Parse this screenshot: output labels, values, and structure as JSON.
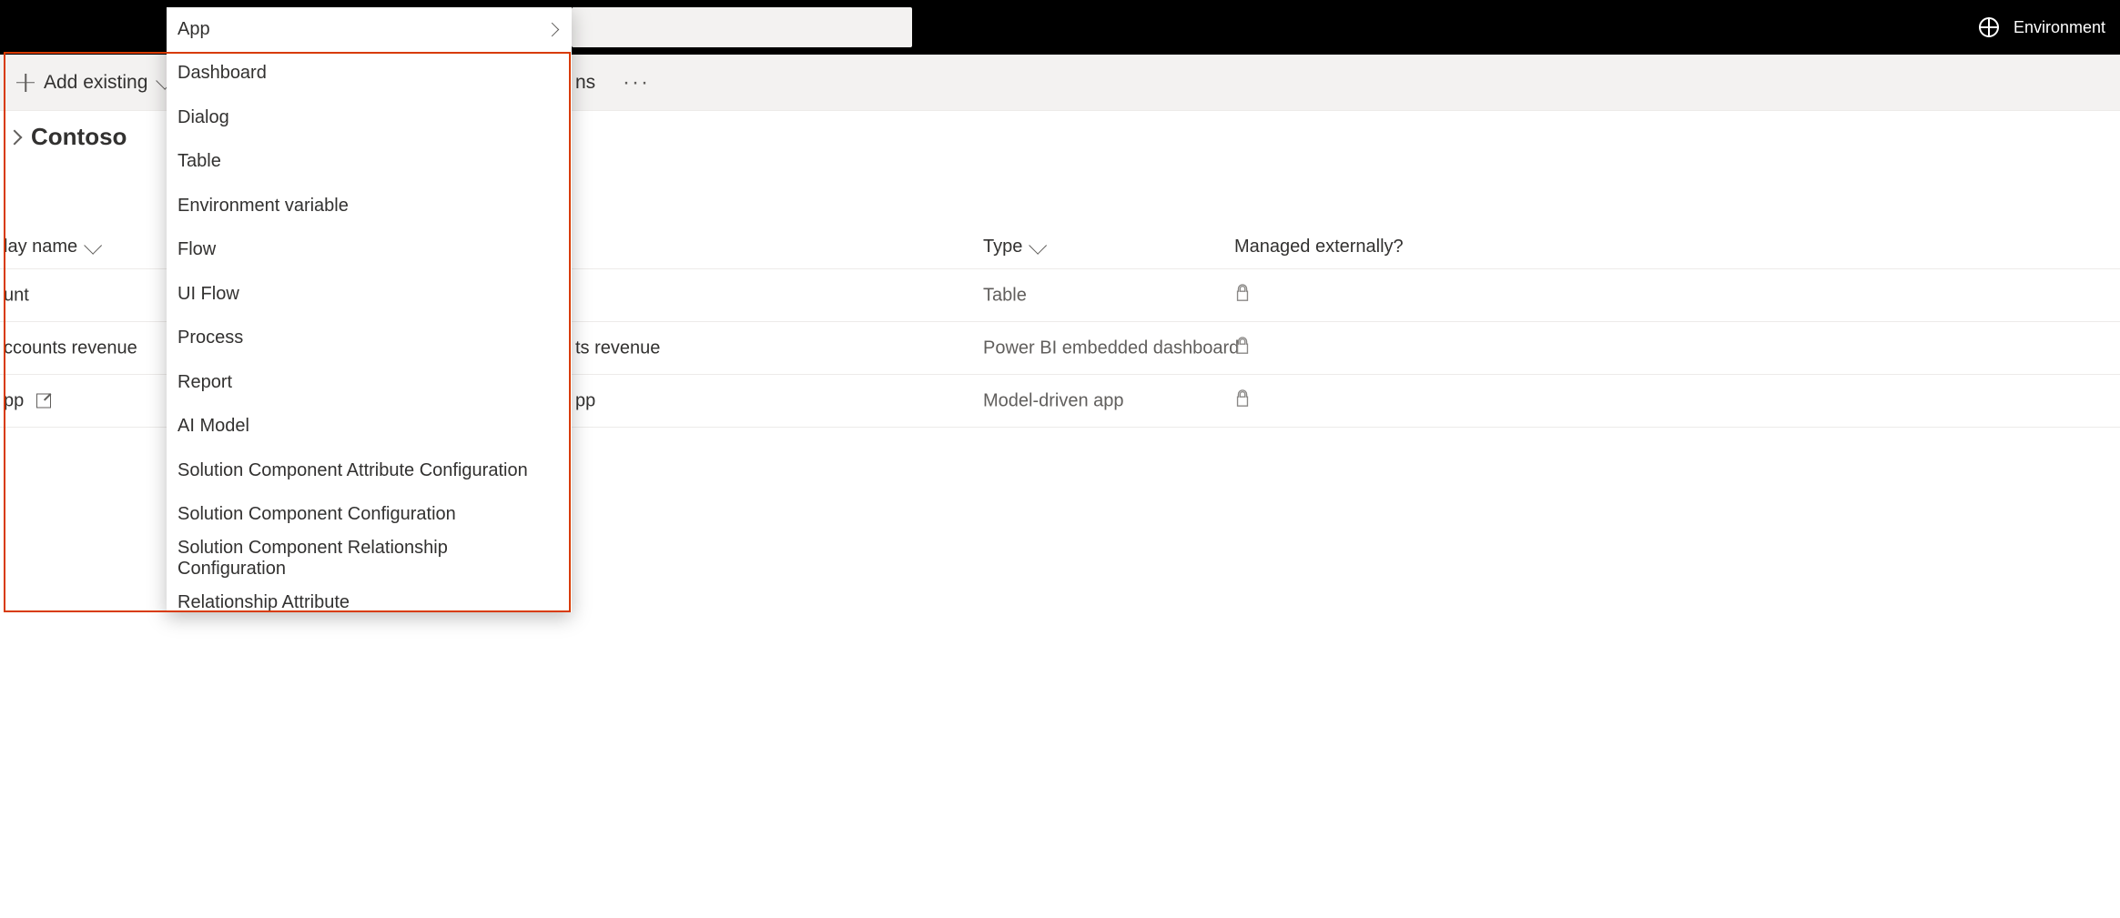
{
  "top": {
    "env_label": "Environment"
  },
  "cmdbar": {
    "add_existing": "Add existing",
    "partial_right": "ns",
    "overflow": "···"
  },
  "crumb": {
    "title": "Contoso"
  },
  "columns": {
    "name": "lay name",
    "type": "Type",
    "ext": "Managed externally?"
  },
  "rows": [
    {
      "name_left": "unt",
      "name_right": "",
      "type": "Table",
      "locked": true
    },
    {
      "name_left": "ccounts revenue",
      "name_right": "ts revenue",
      "type": "Power BI embedded dashboard",
      "locked": true
    },
    {
      "name_left": "pp",
      "name_right": "pp",
      "type": "Model-driven app",
      "locked": true,
      "ext": true
    }
  ],
  "menu": {
    "items": [
      {
        "label": "App",
        "has_children": true
      },
      {
        "label": "Dashboard"
      },
      {
        "label": "Dialog"
      },
      {
        "label": "Table"
      },
      {
        "label": "Environment variable"
      },
      {
        "label": "Flow"
      },
      {
        "label": "UI Flow"
      },
      {
        "label": "Process"
      },
      {
        "label": "Report"
      },
      {
        "label": "AI Model"
      },
      {
        "label": "Solution Component Attribute Configuration"
      },
      {
        "label": "Solution Component Configuration"
      },
      {
        "label": "Solution Component Relationship Configuration"
      },
      {
        "label": "Relationship Attribute"
      }
    ]
  }
}
